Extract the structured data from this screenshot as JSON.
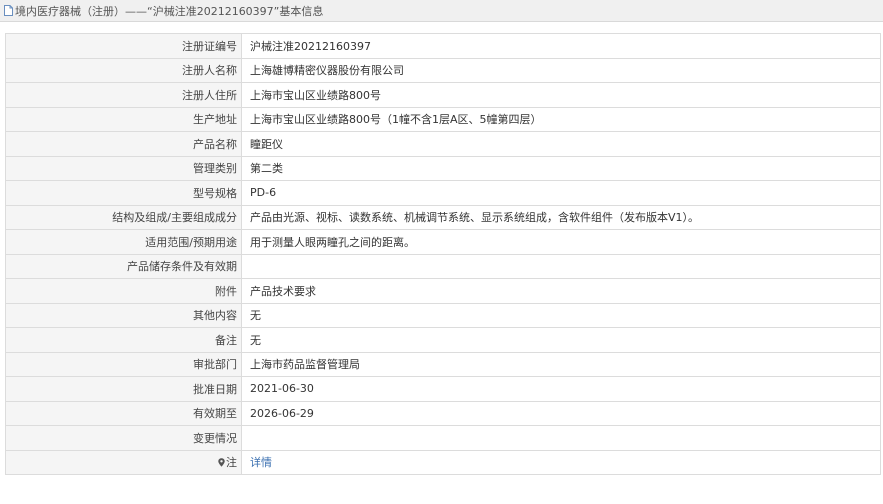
{
  "header": {
    "title": "境内医疗器械（注册）——“沪械注准20212160397”基本信息"
  },
  "rows": [
    {
      "label": "注册证编号",
      "value": "沪械注准20212160397"
    },
    {
      "label": "注册人名称",
      "value": "上海雄博精密仪器股份有限公司"
    },
    {
      "label": "注册人住所",
      "value": "上海市宝山区业绩路800号"
    },
    {
      "label": "生产地址",
      "value": "上海市宝山区业绩路800号（1幢不含1层A区、5幢第四层）"
    },
    {
      "label": "产品名称",
      "value": "瞳距仪"
    },
    {
      "label": "管理类别",
      "value": "第二类"
    },
    {
      "label": "型号规格",
      "value": "PD-6"
    },
    {
      "label": "结构及组成/主要组成成分",
      "value": "产品由光源、视标、读数系统、机械调节系统、显示系统组成，含软件组件（发布版本V1）。"
    },
    {
      "label": "适用范围/预期用途",
      "value": "用于测量人眼两瞳孔之间的距离。"
    },
    {
      "label": "产品储存条件及有效期",
      "value": ""
    },
    {
      "label": "附件",
      "value": "产品技术要求"
    },
    {
      "label": "其他内容",
      "value": "无"
    },
    {
      "label": "备注",
      "value": "无"
    },
    {
      "label": "审批部门",
      "value": "上海市药品监督管理局"
    },
    {
      "label": "批准日期",
      "value": "2021-06-30"
    },
    {
      "label": "有效期至",
      "value": "2026-06-29"
    },
    {
      "label": "变更情况",
      "value": ""
    }
  ],
  "note_row": {
    "label": "注",
    "icon": "location-pin-icon",
    "link_text": "详情"
  },
  "colors": {
    "link": "#3a6fb0",
    "label_bg": "#f5f5f5",
    "border": "#dcdcdc"
  }
}
